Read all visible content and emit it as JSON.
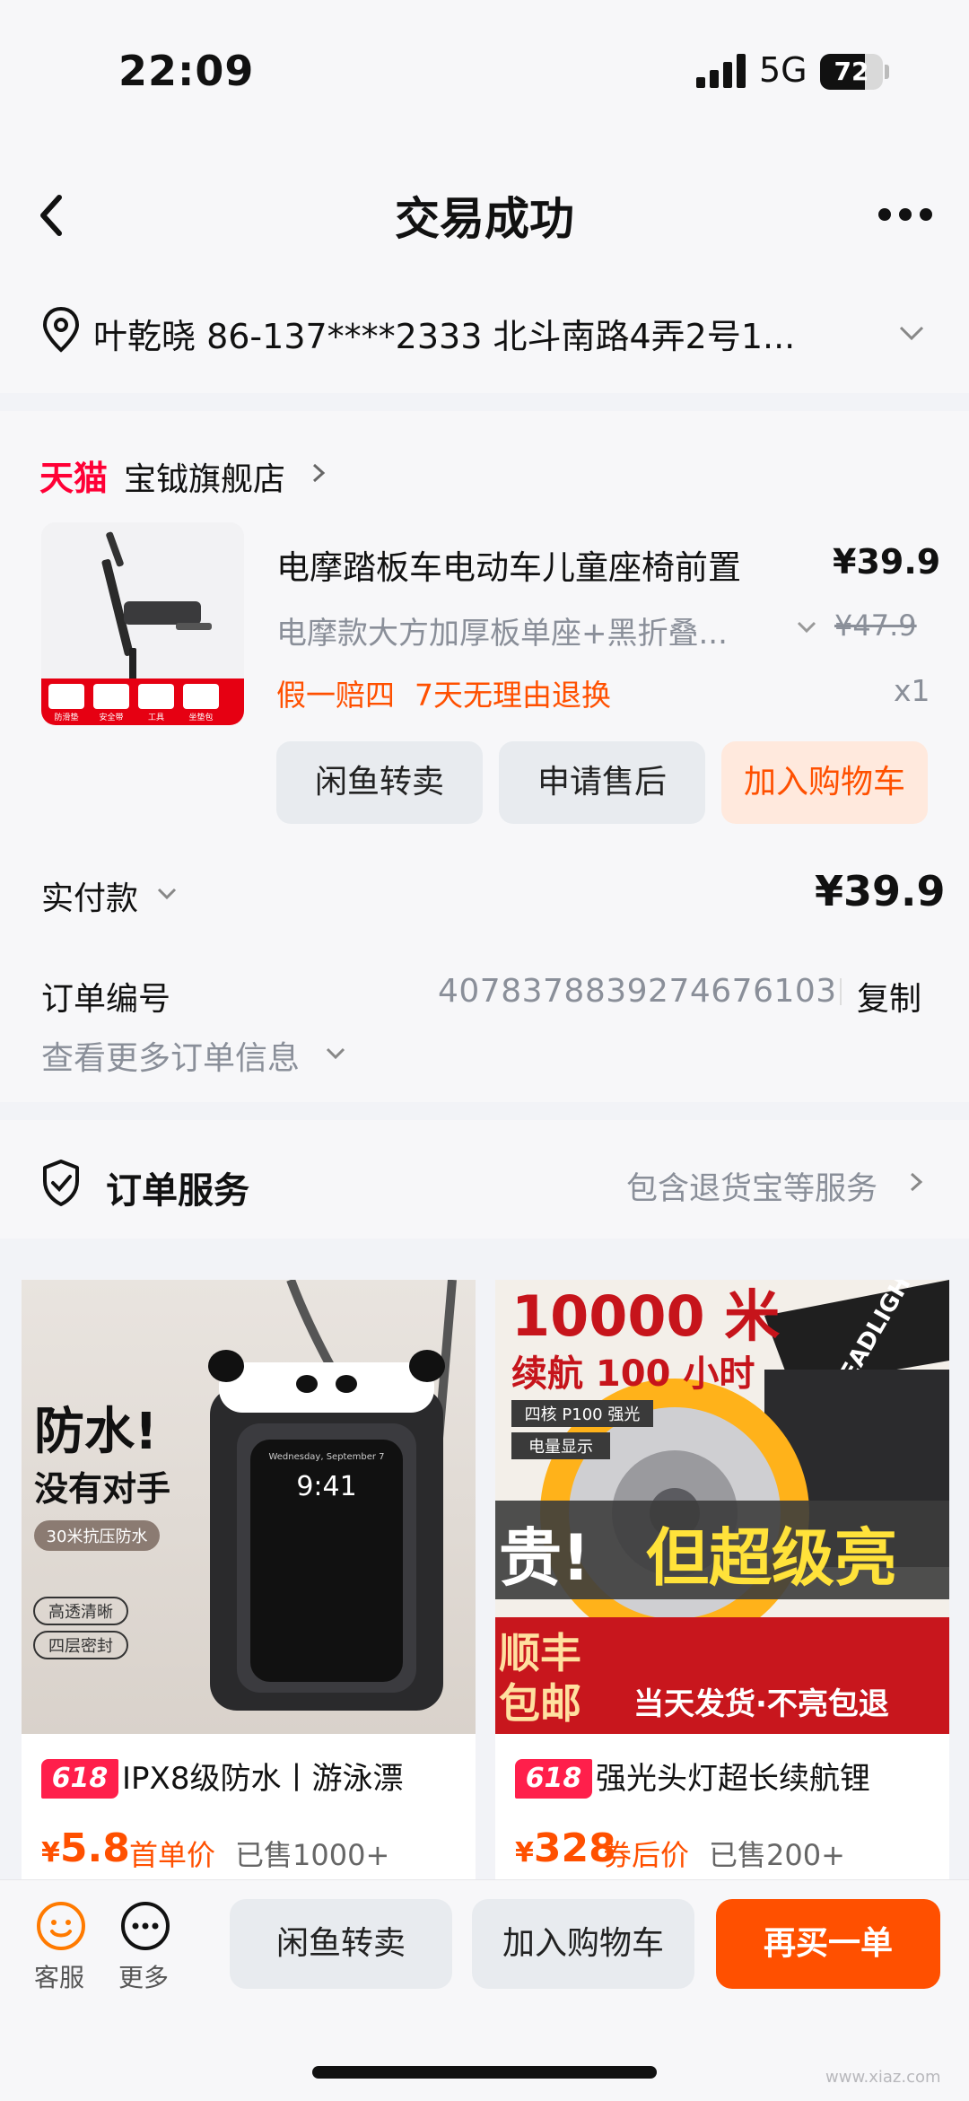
{
  "status_bar": {
    "time": "22:09",
    "network": "5G",
    "battery": "72",
    "battery_level": 0.72
  },
  "header": {
    "title": "交易成功"
  },
  "address": {
    "text": "叶乾晓  86-137****2333  北斗南路4弄2号1..."
  },
  "shop": {
    "brand": "天猫",
    "name": "宝钺旗舰店"
  },
  "product": {
    "title": "电摩踏板车电动车儿童座椅前置",
    "price": "¥39.9",
    "spec": "电摩款大方加厚板单座+黑折叠...",
    "original_price": "¥47.9",
    "promise_1": "假一赔四",
    "promise_2": "7天无理由退换",
    "quantity": "x1",
    "image_labels": [
      "防滑垫",
      "安全带",
      "工具",
      "坐垫包"
    ]
  },
  "actions": {
    "resell": "闲鱼转卖",
    "after_sale": "申请售后",
    "add_cart": "加入购物车"
  },
  "payment": {
    "label": "实付款",
    "amount": "¥39.9"
  },
  "order": {
    "label": "订单编号",
    "number": "4078378839274676103",
    "copy": "复制",
    "more": "查看更多订单信息"
  },
  "service": {
    "title": "订单服务",
    "desc": "包含退货宝等服务"
  },
  "recommendations": [
    {
      "badge": "618",
      "title": "IPX8级防水丨游泳漂",
      "price_symbol": "¥",
      "price": "5.8",
      "price_note": "首单价",
      "sold": "已售1000+",
      "image_text": {
        "headline_1": "防水!",
        "headline_2": "没有对手",
        "tag": "30米抗压防水",
        "feature_1": "高透清晰",
        "feature_2": "四层密封",
        "phone_date": "Wednesday, September 7",
        "phone_time": "9:41"
      }
    },
    {
      "badge": "618",
      "title": "强光头灯超长续航锂",
      "price_symbol": "¥",
      "price": "328",
      "price_note": "券后价",
      "sold": "已售200+",
      "image_text": {
        "headline_1": "10000 米",
        "headline_2": "续航 100 小时",
        "tag_1": "四核 P100 强光",
        "tag_2": "电量显示",
        "strap": "HEADLIGHT",
        "slogan_1": "贵!",
        "slogan_2": "但超级亮",
        "shipping_1": "顺丰",
        "shipping_2": "包邮",
        "shipping_3": "当天发货·不亮包退"
      }
    }
  ],
  "bottom_bar": {
    "service": "客服",
    "more": "更多",
    "resell": "闲鱼转卖",
    "add_cart": "加入购物车",
    "buy_again": "再买一单"
  },
  "watermark": "www.xiaz.com",
  "colors": {
    "accent": "#ff5000",
    "tmall": "#ff0036",
    "badge": "#ff1f4b"
  }
}
